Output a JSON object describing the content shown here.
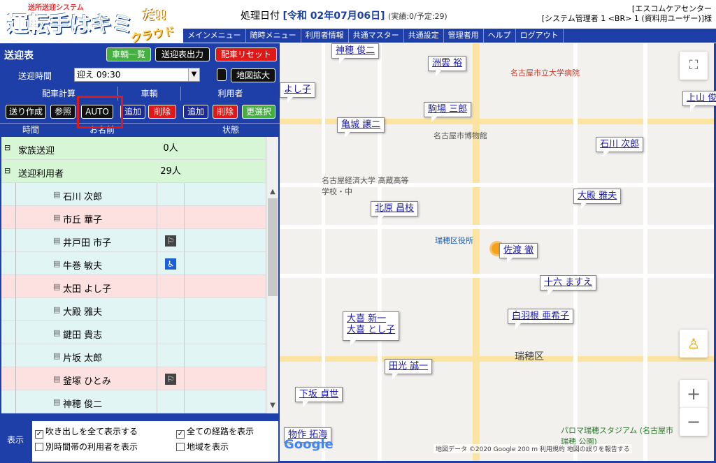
{
  "header": {
    "logo_sub": "送所送迎システム",
    "logo_main": "運転手はキミ",
    "logo_da": "だ!!",
    "logo_cloud": "クラウド",
    "proc_label": "処理日付",
    "proc_date": "[令和 02年07月06日]",
    "proc_stats": "(実績:0/予定:29)",
    "org_line1": "[エスコムケアセンター",
    "org_line2": "[システム管理者 1 <BR> 1 (資料用ユーザー)]様"
  },
  "menu": [
    "メインメニュー",
    "随時メニュー",
    "利用者情報",
    "共通マスター",
    "共通設定",
    "管理者用",
    "ヘルプ",
    "ログアウト"
  ],
  "panel": {
    "title": "送迎表",
    "btn_vehicles": "車輌一覧",
    "btn_output": "送迎表出力",
    "btn_reset": "配車リセット",
    "time_label": "送迎時間",
    "time_value": "迎え 09:30",
    "btn_mapzoom": "地図拡大",
    "grp_calc": "配車計算",
    "grp_vehicle": "車輌",
    "grp_user": "利用者",
    "btn_make": "送り作成",
    "btn_ref": "参照",
    "btn_auto": "AUTO",
    "btn_add1": "追加",
    "btn_del1": "削除",
    "btn_add2": "追加",
    "btn_del2": "削除",
    "btn_select": "更選択",
    "col_time": "時間",
    "col_name": "お名前",
    "col_status": "状態"
  },
  "groups": [
    {
      "name": "家族送迎",
      "count": "0人"
    },
    {
      "name": "送迎利用者",
      "count": "29人"
    }
  ],
  "users": [
    {
      "name": "石川 次郎",
      "row": "blueish",
      "icon": ""
    },
    {
      "name": "市丘 華子",
      "row": "pink",
      "icon": ""
    },
    {
      "name": "井戸田 市子",
      "row": "blueish",
      "icon": "walker"
    },
    {
      "name": "牛巻 敏夫",
      "row": "blueish",
      "icon": "wheelchair"
    },
    {
      "name": "太田 よし子",
      "row": "pink",
      "icon": ""
    },
    {
      "name": "大殿 雅夫",
      "row": "blueish",
      "icon": ""
    },
    {
      "name": "鍵田 貴志",
      "row": "blueish",
      "icon": ""
    },
    {
      "name": "片坂 太郎",
      "row": "blueish",
      "icon": ""
    },
    {
      "name": "釜塚 ひとみ",
      "row": "pink",
      "icon": "walker"
    },
    {
      "name": "神穂 俊二",
      "row": "blueish",
      "icon": ""
    }
  ],
  "display": {
    "label": "表示",
    "opt1": "吹き出しを全て表示する",
    "opt2": "全ての経路を表示",
    "opt3": "別時間帯の利用者を表示",
    "opt4": "地域を表示"
  },
  "balloons": [
    {
      "text": "神穂 俊二"
    },
    {
      "text": "洲雲 裕"
    },
    {
      "text": "よし子"
    },
    {
      "text": "駒場 三郎"
    },
    {
      "text": "上山 俊"
    },
    {
      "text": "亀城 譲二"
    },
    {
      "text": "石川 次郎"
    },
    {
      "text": "大殿 雅夫"
    },
    {
      "text": "北原 昌枝"
    },
    {
      "text": "佐渡 徹"
    },
    {
      "text": "十六 ますえ"
    },
    {
      "text": "白羽根 亜希子"
    },
    {
      "text": "大喜 新一"
    },
    {
      "text": "大喜 とし子"
    },
    {
      "text": "田光 誠一"
    },
    {
      "text": "下坂 貞世"
    },
    {
      "text": "物作 拓海"
    }
  ],
  "map_labels": {
    "hospital": "名古屋市立大学病院",
    "museum": "名古屋市博物館",
    "school": "名古屋経済大学 高蔵高等学校・中",
    "office": "瑞穂区役所",
    "ward": "瑞穂区",
    "stadium": "パロマ瑞穂スタジアム (名古屋市瑞穂 公園)",
    "attribution": "地図データ ©2020 Google   200 m   利用規約   地図の誤りを報告する",
    "google": "Google"
  },
  "colors": {
    "primary": "#1f3fa8",
    "green": "#44b040",
    "red": "#e01818"
  }
}
